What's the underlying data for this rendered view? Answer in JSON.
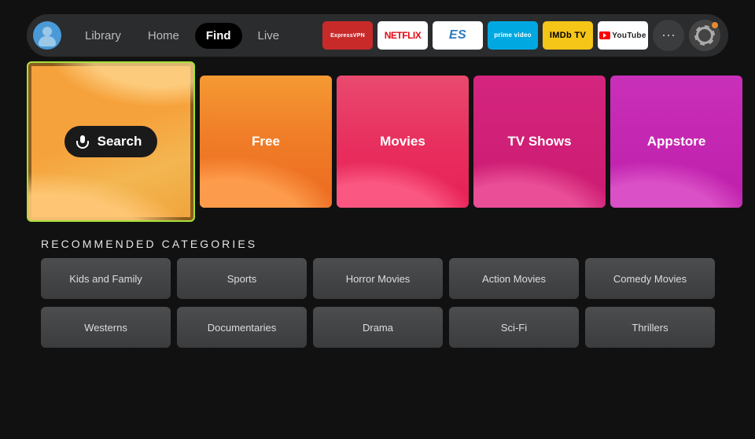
{
  "nav": {
    "items": [
      {
        "label": "Library",
        "active": false
      },
      {
        "label": "Home",
        "active": false
      },
      {
        "label": "Find",
        "active": true
      },
      {
        "label": "Live",
        "active": false
      }
    ]
  },
  "apps": {
    "express": "ExpressVPN",
    "netflix": "NETFLIX",
    "es": "ES",
    "prime": "prime video",
    "imdb": "IMDb TV",
    "youtube": "YouTube"
  },
  "hero": {
    "search_label": "Search",
    "tiles": [
      {
        "label": "Free"
      },
      {
        "label": "Movies"
      },
      {
        "label": "TV Shows"
      },
      {
        "label": "Appstore"
      }
    ]
  },
  "section_title": "RECOMMENDED CATEGORIES",
  "categories": [
    "Kids and Family",
    "Sports",
    "Horror Movies",
    "Action Movies",
    "Comedy Movies",
    "Westerns",
    "Documentaries",
    "Drama",
    "Sci-Fi",
    "Thrillers"
  ]
}
